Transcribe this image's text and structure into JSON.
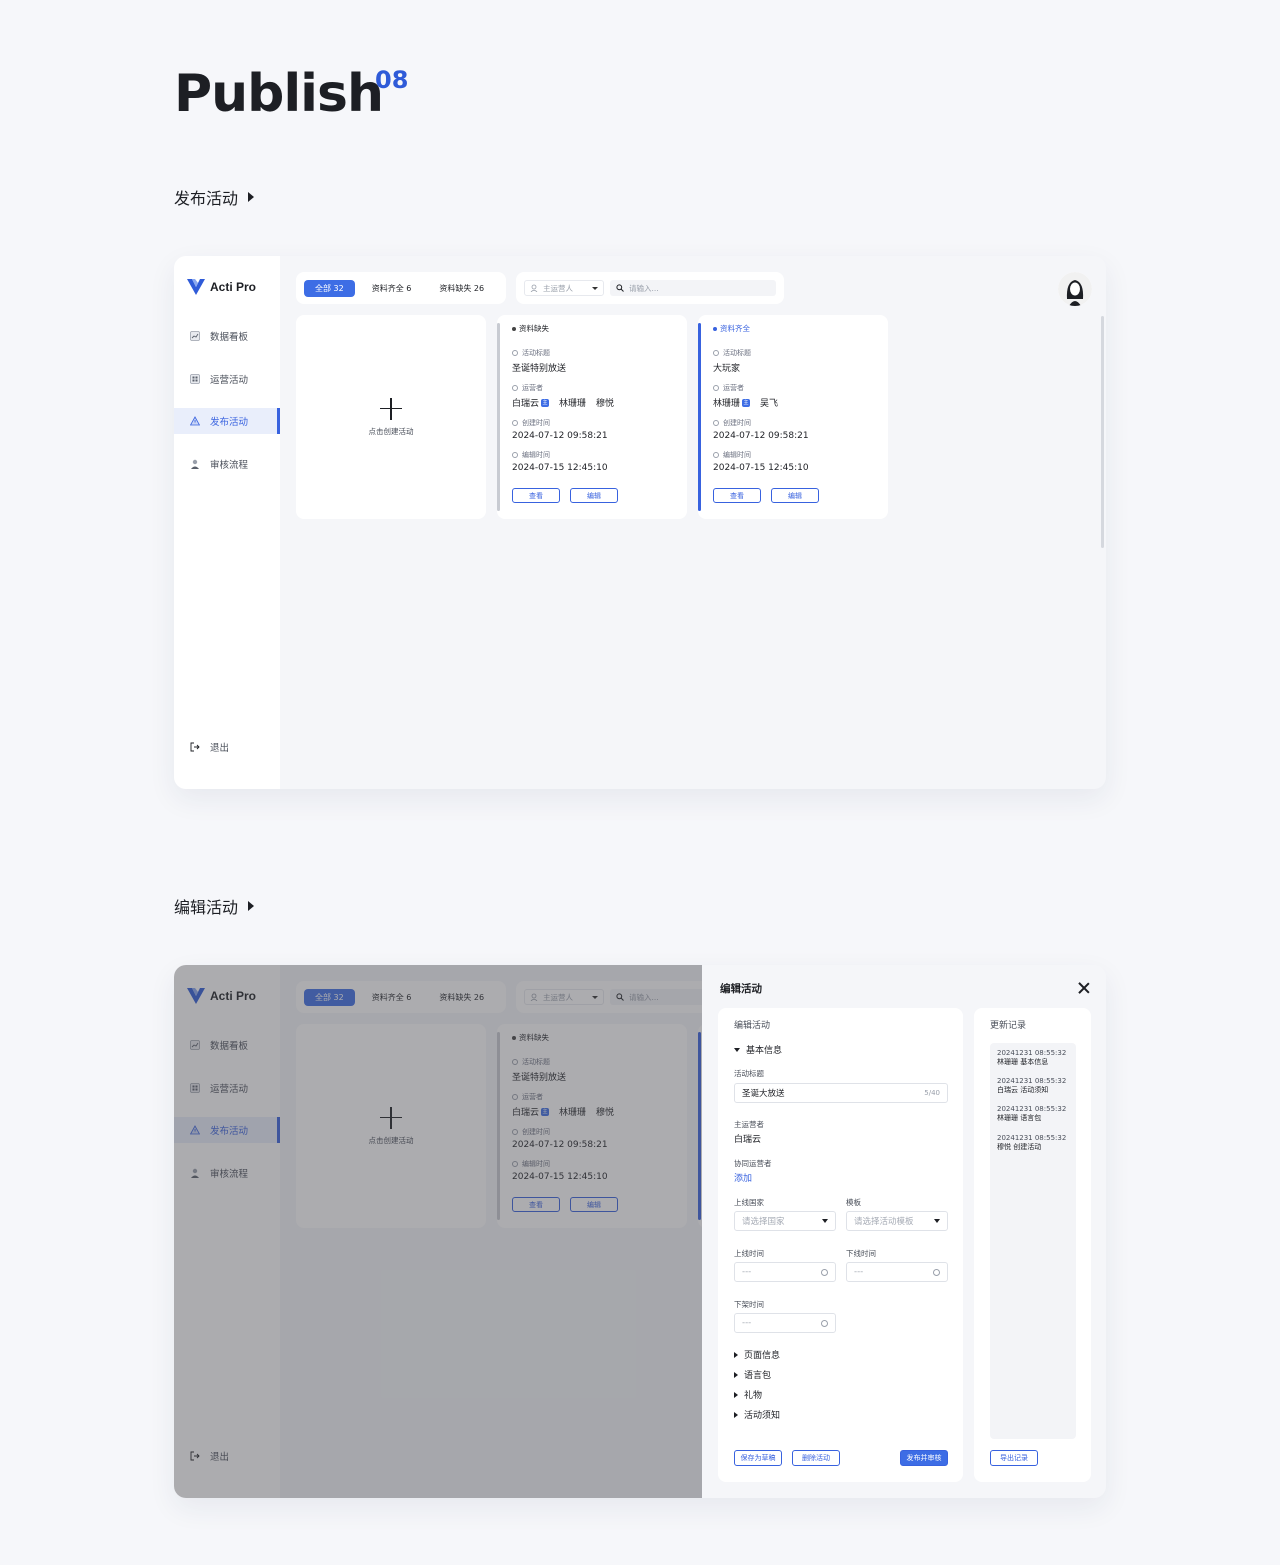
{
  "page": {
    "title": "Publish",
    "number": "08"
  },
  "section1": {
    "title": "发布活动"
  },
  "section2": {
    "title": "编辑活动"
  },
  "app": {
    "name": "Acti Pro",
    "sidebar": [
      {
        "label": "数据看板",
        "icon": "chart-icon"
      },
      {
        "label": "运营活动",
        "icon": "grid-icon"
      },
      {
        "label": "发布活动",
        "icon": "warning-icon",
        "active": true
      },
      {
        "label": "审核流程",
        "icon": "person-icon"
      }
    ],
    "logout": "退出",
    "tabs": [
      {
        "label": "全部 32",
        "active": true
      },
      {
        "label": "资料齐全 6"
      },
      {
        "label": "资料缺失 26"
      }
    ],
    "filter": {
      "operator_placeholder": "主运营人",
      "search_placeholder": "请输入..."
    },
    "create_label": "点击创建活动",
    "cards": [
      {
        "status": "资料缺失",
        "title_label": "活动标题",
        "title": "圣诞特别放送",
        "operator_label": "运营者",
        "operators": [
          "白瑞云",
          "林珊珊",
          "穆悦"
        ],
        "created_label": "创建时间",
        "created": "2024-07-12 09:58:21",
        "edited_label": "编辑时间",
        "edited": "2024-07-15 12:45:10",
        "view_label": "查看",
        "edit_label": "编辑"
      },
      {
        "status": "资料齐全",
        "title_label": "活动标题",
        "title": "大玩家",
        "operator_label": "运营者",
        "operators": [
          "林珊珊",
          "吴飞"
        ],
        "created_label": "创建时间",
        "created": "2024-07-12 09:58:21",
        "edited_label": "编辑时间",
        "edited": "2024-07-15 12:45:10",
        "view_label": "查看",
        "edit_label": "编辑"
      }
    ],
    "main_badge": "主"
  },
  "drawer": {
    "title": "编辑活动",
    "form_header": "编辑活动",
    "basic_section": "基本信息",
    "activity_title_label": "活动标题",
    "activity_title_value": "圣诞大放送",
    "activity_title_count": "5/40",
    "main_operator_label": "主运营者",
    "main_operator_value": "白瑞云",
    "co_operator_label": "协同运营者",
    "co_operator_add": "添加",
    "country_label": "上线国家",
    "country_placeholder": "请选择国家",
    "template_label": "模板",
    "template_placeholder": "请选择活动模板",
    "online_time_label": "上线时间",
    "offline_time_label": "下线时间",
    "shelf_time_label": "下架时间",
    "time_placeholder": "---",
    "collapsed_sections": [
      "页面信息",
      "语言包",
      "礼物",
      "活动须知"
    ],
    "save_draft": "保存为草稿",
    "delete": "删除活动",
    "publish": "发布并审核",
    "log_header": "更新记录",
    "logs": [
      {
        "time": "20241231 08:55:32",
        "desc": "林珊珊 基本信息"
      },
      {
        "time": "20241231 08:55:32",
        "desc": "白瑞云 活动须知"
      },
      {
        "time": "20241231 08:55:32",
        "desc": "林珊珊 语言包"
      },
      {
        "time": "20241231 08:55:32",
        "desc": "穆悦 创建活动"
      }
    ],
    "export": "导出记录"
  },
  "colors": {
    "accent": "#3862df",
    "background": "#f6f7fa"
  }
}
